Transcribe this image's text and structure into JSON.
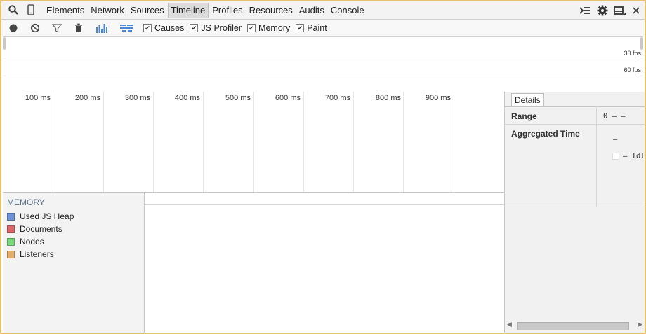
{
  "tabs": [
    {
      "label": "Elements"
    },
    {
      "label": "Network"
    },
    {
      "label": "Sources"
    },
    {
      "label": "Timeline",
      "active": true
    },
    {
      "label": "Profiles"
    },
    {
      "label": "Resources"
    },
    {
      "label": "Audits"
    },
    {
      "label": "Console"
    }
  ],
  "toolbar": {
    "checks": [
      {
        "label": "Causes",
        "checked": true
      },
      {
        "label": "JS Profiler",
        "checked": true
      },
      {
        "label": "Memory",
        "checked": true
      },
      {
        "label": "Paint",
        "checked": true
      }
    ]
  },
  "overview": {
    "fps30": "30 fps",
    "fps60": "60 fps"
  },
  "ruler": {
    "ticks": [
      "100 ms",
      "200 ms",
      "300 ms",
      "400 ms",
      "500 ms",
      "600 ms",
      "700 ms",
      "800 ms",
      "900 ms"
    ]
  },
  "memory": {
    "title": "MEMORY",
    "legend": [
      {
        "label": "Used JS Heap",
        "color": "#6f93d6"
      },
      {
        "label": "Documents",
        "color": "#d9686b"
      },
      {
        "label": "Nodes",
        "color": "#7ad87a"
      },
      {
        "label": "Listeners",
        "color": "#e2ae6d"
      }
    ]
  },
  "details": {
    "tab": "Details",
    "range_label": "Range",
    "range_value": "0 – –",
    "aggregated_label": "Aggregated Time",
    "aggregated_dash": "–",
    "aggregated_item": "– Idl"
  },
  "colors": {
    "frame_border": "#e4c36a",
    "accent_blue": "#4a87d6"
  }
}
